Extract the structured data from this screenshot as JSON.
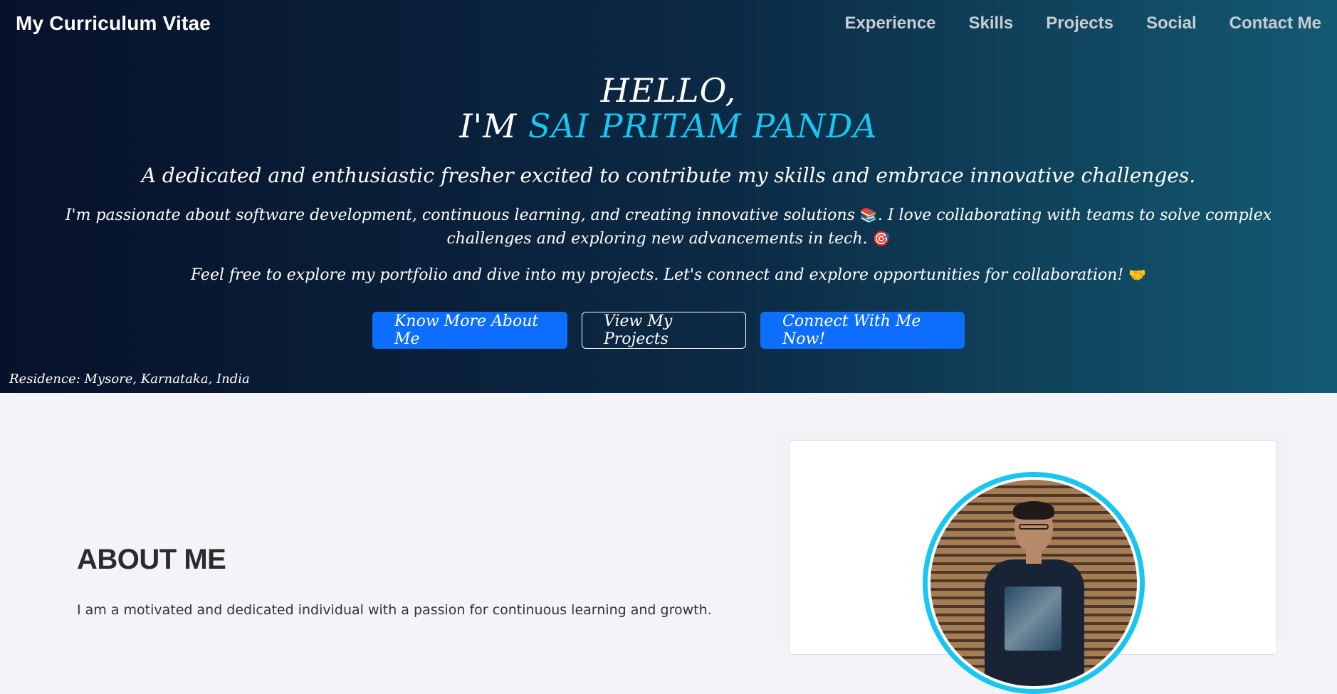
{
  "navbar": {
    "brand": "My Curriculum Vitae",
    "links": [
      "Experience",
      "Skills",
      "Projects",
      "Social",
      "Contact Me"
    ]
  },
  "hero": {
    "greeting": "HELLO,",
    "intro_prefix": "I'M ",
    "name": "SAI PRITAM PANDA",
    "tagline": "A dedicated and enthusiastic fresher excited to contribute my skills and embrace innovative challenges.",
    "para1_text": "I'm passionate about software development, continuous learning, and creating innovative solutions ",
    "para1_emoji1": "📚",
    "para1_text2": ". I love collaborating with teams to solve complex challenges and exploring new advancements in tech. ",
    "para1_emoji2": "🎯",
    "para2_text": "Feel free to explore my portfolio and dive into my projects. Let's connect and explore opportunities for collaboration! ",
    "para2_emoji": "🤝",
    "buttons": [
      "Know More About Me",
      "View My Projects",
      "Connect With Me Now!"
    ],
    "residence": "Residence: Mysore, Karnataka, India"
  },
  "about": {
    "heading": "ABOUT ME",
    "text": "I am a motivated and dedicated individual with a passion for continuous learning and growth."
  },
  "colors": {
    "accent": "#18c6f2",
    "primary_button": "#0d6efd",
    "hero_gradient_start": "#07112a",
    "hero_gradient_end": "#135a72"
  }
}
